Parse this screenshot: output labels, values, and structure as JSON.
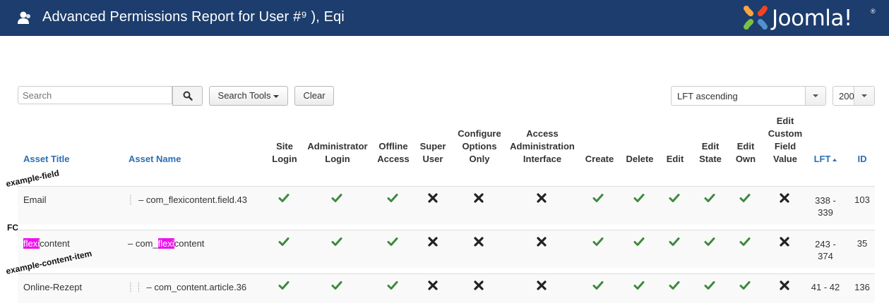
{
  "header": {
    "title": "Advanced Permissions Report for User #",
    "title_masked": "⁹ ), Eqi",
    "brand": "Joomla!",
    "reg": "®"
  },
  "toolbar": {
    "search_placeholder": "Search",
    "search_tools_label": "Search Tools",
    "clear_label": "Clear",
    "ordering_value": "LFT ascending",
    "limit_value": "200"
  },
  "table": {
    "columns": {
      "asset_title": "Asset Title",
      "asset_name": "Asset Name",
      "site_login": [
        "Site",
        "Login"
      ],
      "admin_login": [
        "Administrator",
        "Login"
      ],
      "offline": [
        "Offline",
        "Access"
      ],
      "super_user": [
        "Super",
        "User"
      ],
      "configure": [
        "Configure",
        "Options",
        "Only"
      ],
      "access_admin": [
        "Access",
        "Administration",
        "Interface"
      ],
      "create": "Create",
      "delete": "Delete",
      "edit": "Edit",
      "edit_state": [
        "Edit",
        "State"
      ],
      "edit_own": [
        "Edit",
        "Own"
      ],
      "edit_custom": [
        "Edit",
        "Custom",
        "Field",
        "Value"
      ],
      "lft": "LFT",
      "id": "ID"
    },
    "rows": [
      {
        "title": "Email",
        "tree": "┊",
        "name": "– com_flexicontent.field.43",
        "perms": [
          "yes",
          "yes",
          "yes",
          "no",
          "no",
          "no",
          "yes",
          "yes",
          "yes",
          "yes",
          "yes",
          "no"
        ],
        "lft": [
          "338 -",
          "339"
        ],
        "id": "103"
      },
      {
        "title_hl": "flexi",
        "title_rest": "content",
        "name_prefix": "– com_",
        "name_hl": "flexi",
        "name_rest": "content",
        "perms": [
          "yes",
          "yes",
          "yes",
          "no",
          "no",
          "no",
          "yes",
          "yes",
          "yes",
          "yes",
          "yes",
          "no"
        ],
        "lft": [
          "243 -",
          "374"
        ],
        "id": "35"
      },
      {
        "title": "Online-Rezept",
        "tree": "┊  ┊",
        "name": "– com_content.article.36",
        "perms": [
          "yes",
          "yes",
          "yes",
          "no",
          "no",
          "no",
          "yes",
          "yes",
          "yes",
          "yes",
          "yes",
          "no"
        ],
        "lft": [
          "41 - 42"
        ],
        "id": "136"
      }
    ]
  },
  "annotations": {
    "example_field": "example-field",
    "fc": "FC",
    "example_content_item": "example-content-item"
  },
  "colors": {
    "header_bg": "#1c3d6d",
    "link": "#2a6fb4",
    "check": "#3c8a3c",
    "cross": "#222222",
    "highlight": "#ee11ee"
  }
}
